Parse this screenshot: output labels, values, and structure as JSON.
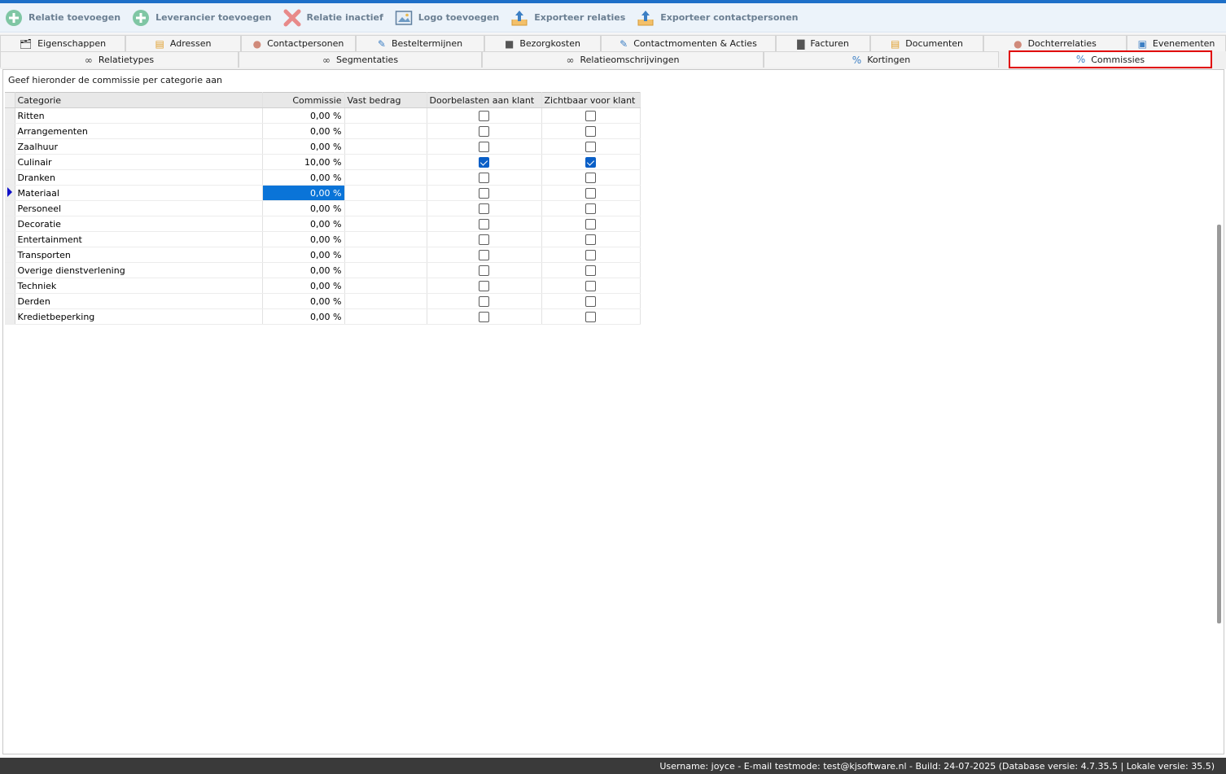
{
  "toolbar": {
    "buttons": [
      {
        "label": "Relatie toevoegen",
        "icon": "add-circle-icon"
      },
      {
        "label": "Leverancier toevoegen",
        "icon": "add-circle-icon"
      },
      {
        "label": "Relatie inactief",
        "icon": "x-icon"
      },
      {
        "label": "Logo toevoegen",
        "icon": "image-icon"
      },
      {
        "label": "Exporteer relaties",
        "icon": "export-icon"
      },
      {
        "label": "Exporteer contactpersonen",
        "icon": "export-icon"
      }
    ]
  },
  "tabs": {
    "row1": [
      {
        "label": "Eigenschappen",
        "icon": "properties-icon"
      },
      {
        "label": "Adressen",
        "icon": "address-icon"
      },
      {
        "label": "Contactpersonen",
        "icon": "contacts-icon"
      },
      {
        "label": "Besteltermijnen",
        "icon": "edit-icon"
      },
      {
        "label": "Bezorgkosten",
        "icon": "truck-icon"
      },
      {
        "label": "Contactmomenten & Acties",
        "icon": "edit-icon"
      },
      {
        "label": "Facturen",
        "icon": "chart-icon"
      },
      {
        "label": "Documenten",
        "icon": "document-icon"
      },
      {
        "label": "Dochterrelaties",
        "icon": "people-icon"
      },
      {
        "label": "Evenementen",
        "icon": "event-icon"
      }
    ],
    "row2": [
      {
        "label": "Relatietypes",
        "icon": "binoculars-icon"
      },
      {
        "label": "Segmentaties",
        "icon": "binoculars-icon"
      },
      {
        "label": "Relatieomschrijvingen",
        "icon": "binoculars-icon"
      },
      {
        "label": "Kortingen",
        "icon": "percent-icon"
      },
      {
        "label": "Commissies",
        "icon": "percent-icon",
        "active": true
      }
    ]
  },
  "panel": {
    "instruction": "Geef hieronder de commissie per categorie aan"
  },
  "grid": {
    "columns": [
      "Categorie",
      "Commissie",
      "Vast bedrag",
      "Doorbelasten aan klant",
      "Zichtbaar voor klant"
    ],
    "rows": [
      {
        "categorie": "Ritten",
        "commissie": "0,00 %",
        "vast": "",
        "door": false,
        "zicht": false
      },
      {
        "categorie": "Arrangementen",
        "commissie": "0,00 %",
        "vast": "",
        "door": false,
        "zicht": false
      },
      {
        "categorie": "Zaalhuur",
        "commissie": "0,00 %",
        "vast": "",
        "door": false,
        "zicht": false
      },
      {
        "categorie": "Culinair",
        "commissie": "10,00 %",
        "vast": "",
        "door": true,
        "zicht": true
      },
      {
        "categorie": "Dranken",
        "commissie": "0,00 %",
        "vast": "",
        "door": false,
        "zicht": false
      },
      {
        "categorie": "Materiaal",
        "commissie": "0,00 %",
        "vast": "",
        "door": false,
        "zicht": false,
        "current": true
      },
      {
        "categorie": "Personeel",
        "commissie": "0,00 %",
        "vast": "",
        "door": false,
        "zicht": false
      },
      {
        "categorie": "Decoratie",
        "commissie": "0,00 %",
        "vast": "",
        "door": false,
        "zicht": false
      },
      {
        "categorie": "Entertainment",
        "commissie": "0,00 %",
        "vast": "",
        "door": false,
        "zicht": false
      },
      {
        "categorie": "Transporten",
        "commissie": "0,00 %",
        "vast": "",
        "door": false,
        "zicht": false
      },
      {
        "categorie": "Overige dienstverlening",
        "commissie": "0,00 %",
        "vast": "",
        "door": false,
        "zicht": false
      },
      {
        "categorie": "Techniek",
        "commissie": "0,00 %",
        "vast": "",
        "door": false,
        "zicht": false
      },
      {
        "categorie": "Derden",
        "commissie": "0,00 %",
        "vast": "",
        "door": false,
        "zicht": false
      },
      {
        "categorie": "Kredietbeperking",
        "commissie": "0,00 %",
        "vast": "",
        "door": false,
        "zicht": false
      }
    ]
  },
  "status": {
    "text": "Username: joyce - E-mail testmode: test@kjsoftware.nl - Build: 24-07-2025 (Database versie: 4.7.35.5 | Lokale versie: 35.5)"
  },
  "colors": {
    "accent": "#1e6fc8",
    "selection": "#0a74d8",
    "highlight_box": "#e00000",
    "status_bar": "#3a3a3a"
  }
}
